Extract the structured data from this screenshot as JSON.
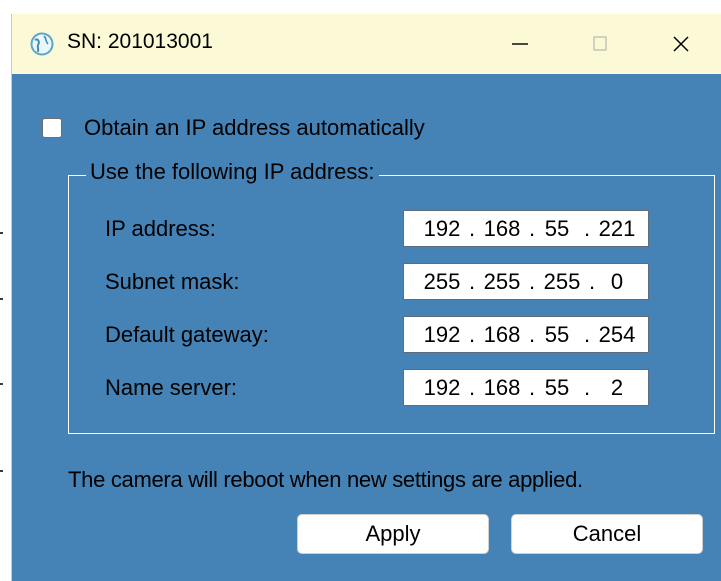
{
  "window": {
    "title": "SN: 201013001",
    "app_icon": "globe-icon",
    "minimize_icon": "minimize-icon",
    "maximize_icon": "maximize-icon",
    "close_icon": "close-icon"
  },
  "auto_ip": {
    "label": "Obtain an IP address automatically",
    "checked": false
  },
  "static_group": {
    "legend": "Use the following IP address:",
    "fields": [
      {
        "label": "IP address:",
        "octets": [
          "192",
          "168",
          "55",
          "221"
        ]
      },
      {
        "label": "Subnet mask:",
        "octets": [
          "255",
          "255",
          "255",
          "0"
        ]
      },
      {
        "label": "Default gateway:",
        "octets": [
          "192",
          "168",
          "55",
          "254"
        ]
      },
      {
        "label": "Name server:",
        "octets": [
          "192",
          "168",
          "55",
          "2"
        ]
      }
    ]
  },
  "notice": "The camera will reboot when new settings are applied.",
  "buttons": {
    "apply": "Apply",
    "cancel": "Cancel"
  },
  "colors": {
    "dialog_bg": "#4582b6",
    "titlebar_bg": "#fbf9d6"
  }
}
